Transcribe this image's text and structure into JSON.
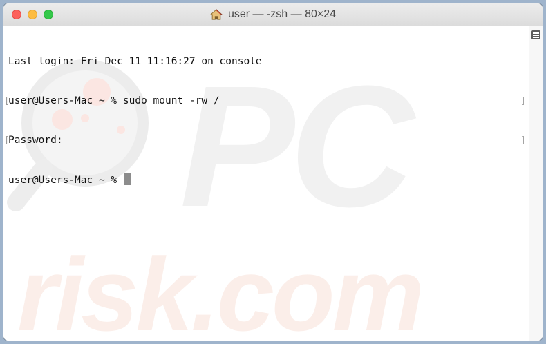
{
  "window": {
    "title": "user — -zsh — 80×24",
    "title_icon": "home-icon"
  },
  "terminal": {
    "lines": [
      "Last login: Fri Dec 11 11:16:27 on console",
      "user@Users-Mac ~ % sudo mount -rw /",
      "Password:",
      "user@Users-Mac ~ % "
    ],
    "marked_lines": [
      1,
      2
    ]
  },
  "watermark": {
    "text_top": "PC",
    "text_bottom": "risk.com"
  },
  "colors": {
    "close": "#fc605c",
    "minimize": "#fdbc40",
    "zoom": "#34c84a",
    "text": "#111111",
    "cursor": "#8c8c8c"
  }
}
